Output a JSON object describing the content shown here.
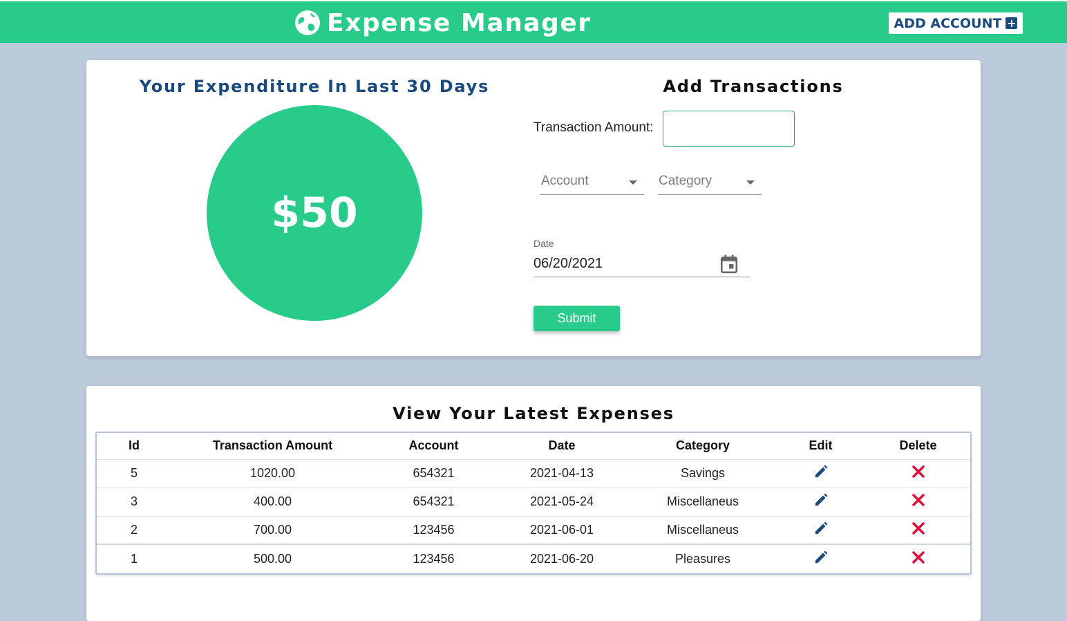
{
  "header": {
    "title": "Expense Manager",
    "add_account_label": "ADD ACCOUNT",
    "add_icon": "+",
    "brand_color": "#29cb8b",
    "accent_color": "#1b4a7e"
  },
  "summary": {
    "title": "Your Expenditure In Last 30 Days",
    "amount": "$50"
  },
  "form": {
    "title": "Add Transactions",
    "amount_label": "Transaction Amount:",
    "amount_value": "",
    "account_placeholder": "Account",
    "category_placeholder": "Category",
    "date_label": "Date",
    "date_value": "06/20/2021",
    "submit_label": "Submit"
  },
  "expenses": {
    "title": "View Your Latest Expenses",
    "headers": [
      "Id",
      "Transaction Amount",
      "Account",
      "Date",
      "Category",
      "Edit",
      "Delete"
    ],
    "rows": [
      {
        "id": "5",
        "amount": "1020.00",
        "account": "654321",
        "date": "2021-04-13",
        "category": "Savings"
      },
      {
        "id": "3",
        "amount": "400.00",
        "account": "654321",
        "date": "2021-05-24",
        "category": "Miscellaneus"
      },
      {
        "id": "2",
        "amount": "700.00",
        "account": "123456",
        "date": "2021-06-01",
        "category": "Miscellaneus"
      },
      {
        "id": "1",
        "amount": "500.00",
        "account": "123456",
        "date": "2021-06-20",
        "category": "Pleasures"
      }
    ]
  }
}
